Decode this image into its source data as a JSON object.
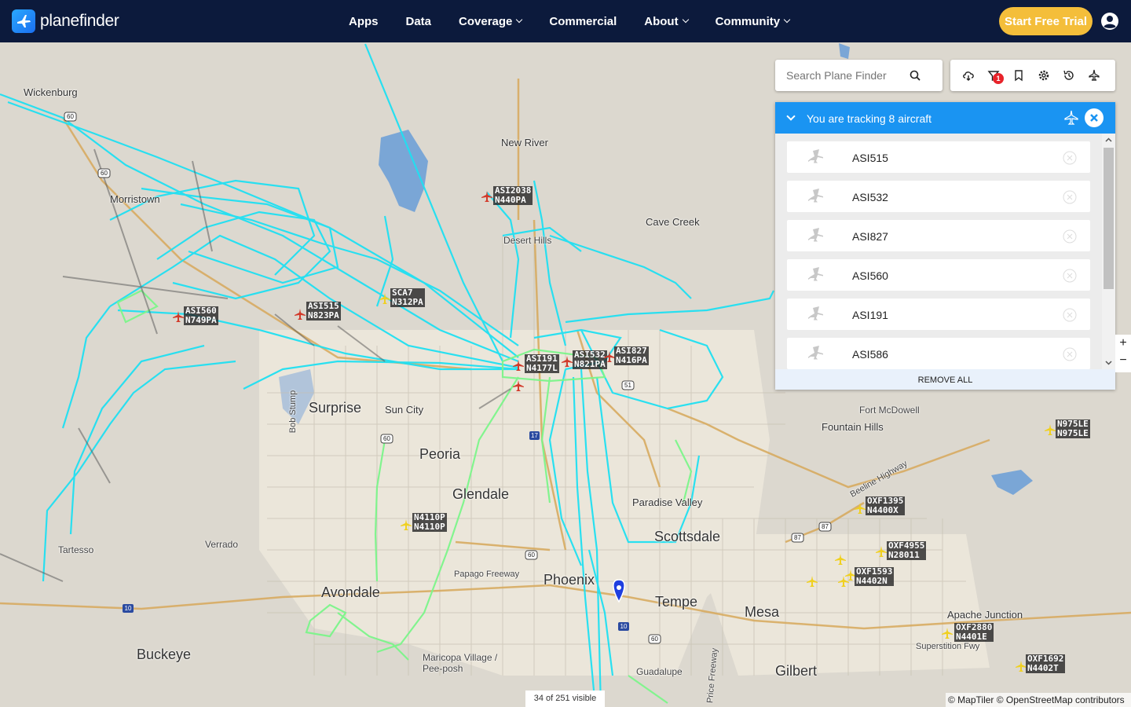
{
  "header": {
    "brand": "planefinder",
    "nav": [
      "Apps",
      "Data",
      "Coverage",
      "Commercial",
      "About",
      "Community"
    ],
    "trial_button": "Start Free Trial"
  },
  "search": {
    "placeholder": "Search Plane Finder"
  },
  "toolbar": {
    "filter_badge": "1"
  },
  "tracking": {
    "title": "You are tracking 8 aircraft",
    "items": [
      "ASI515",
      "ASI532",
      "ASI827",
      "ASI560",
      "ASI191",
      "ASI586"
    ],
    "remove_all": "REMOVE ALL"
  },
  "map": {
    "cities_big": [
      "Surprise",
      "Peoria",
      "Glendale",
      "Scottsdale",
      "Phoenix",
      "Avondale",
      "Tempe",
      "Mesa",
      "Buckeye",
      "Gilbert"
    ],
    "cities_med": [
      "Wickenburg",
      "Morristown",
      "New River",
      "Cave Creek",
      "Sun City",
      "Fountain Hills",
      "Fort McDowell",
      "Paradise Valley",
      "Verrado",
      "Tartesso",
      "Maricopa Village / Pee-posh",
      "Guadalupe",
      "Apache Junction",
      "Papago Freeway",
      "Beeline Highway",
      "Superstition Fwy",
      "Price Freeway",
      "Bob Stump",
      "Desert Hills"
    ],
    "aircraft": [
      {
        "cs": "ASI2038",
        "reg": "N440PA"
      },
      {
        "cs": "SCA7",
        "reg": "N312PA"
      },
      {
        "cs": "ASI515",
        "reg": "N823PA"
      },
      {
        "cs": "ASI560",
        "reg": "N749PA"
      },
      {
        "cs": "ASI191",
        "reg": "N4177L"
      },
      {
        "cs": "ASI532",
        "reg": "N821PA"
      },
      {
        "cs": "ASI827",
        "reg": "N416PA"
      },
      {
        "cs": "N975LE",
        "reg": "N975LE"
      },
      {
        "cs": "OXF1395",
        "reg": "N4400X"
      },
      {
        "cs": "N4110P",
        "reg": "N4110P"
      },
      {
        "cs": "OXF4955",
        "reg": "N28011"
      },
      {
        "cs": "OXF1593",
        "reg": "N4402N"
      },
      {
        "cs": "OXF2880",
        "reg": "N4401E"
      },
      {
        "cs": "OXF1692",
        "reg": "N4402T"
      }
    ],
    "highway_shields": [
      "60",
      "60",
      "60",
      "51",
      "17",
      "87",
      "87",
      "60",
      "10",
      "10",
      "60"
    ]
  },
  "footer": {
    "visible": "34 of 251 visible",
    "attribution": "© MapTiler © OpenStreetMap contributors"
  },
  "colors": {
    "nav_bg": "#0c1a3c",
    "accent": "#1a94f2",
    "trial": "#f4be3a",
    "track": "#1fe0f2",
    "track_green": "#7cf58a"
  }
}
